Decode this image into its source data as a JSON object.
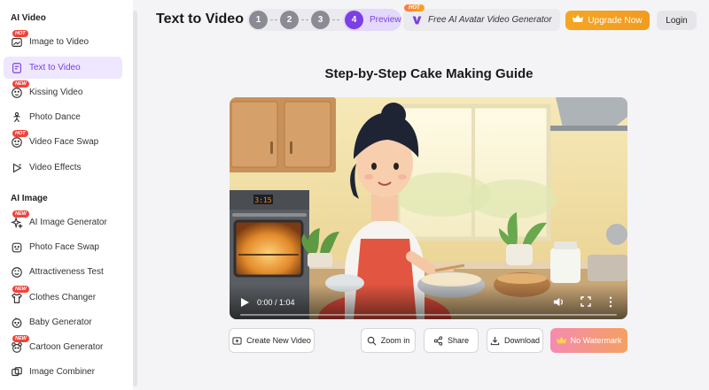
{
  "sidebar": {
    "sections": [
      {
        "title": "AI Video",
        "items": [
          {
            "label": "Image to Video",
            "icon": "image-video-icon",
            "badge": "HOT"
          },
          {
            "label": "Text to Video",
            "icon": "text-video-icon",
            "badge": "",
            "active": true
          },
          {
            "label": "Kissing Video",
            "icon": "kissing-icon",
            "badge": "NEW"
          },
          {
            "label": "Photo Dance",
            "icon": "dance-icon",
            "badge": ""
          },
          {
            "label": "Video Face Swap",
            "icon": "face-swap-icon",
            "badge": "HOT"
          },
          {
            "label": "Video Effects",
            "icon": "effects-icon",
            "badge": ""
          }
        ]
      },
      {
        "title": "AI Image",
        "items": [
          {
            "label": "AI Image Generator",
            "icon": "sparkle-icon",
            "badge": "NEW"
          },
          {
            "label": "Photo Face Swap",
            "icon": "face-icon",
            "badge": ""
          },
          {
            "label": "Attractiveness Test",
            "icon": "heart-face-icon",
            "badge": ""
          },
          {
            "label": "Clothes Changer",
            "icon": "shirt-icon",
            "badge": "NEW"
          },
          {
            "label": "Baby Generator",
            "icon": "baby-icon",
            "badge": ""
          },
          {
            "label": "Cartoon Generator",
            "icon": "cartoon-icon",
            "badge": "NEW"
          },
          {
            "label": "Image Combiner",
            "icon": "combine-icon",
            "badge": ""
          }
        ]
      }
    ]
  },
  "header": {
    "title": "Text to Video",
    "steps": [
      "1",
      "2",
      "3"
    ],
    "active_step": {
      "number": "4",
      "label": "Preview"
    },
    "promo": {
      "badge": "HOT",
      "text": "Free AI Avatar Video Generator"
    },
    "upgrade_label": "Upgrade Now",
    "login_label": "Login"
  },
  "main": {
    "video_title": "Step-by-Step Cake Making Guide",
    "player": {
      "time": "0:00 / 1:04",
      "progress": 0
    },
    "oven_display": "3:15",
    "buttons": {
      "create": "Create New Video",
      "zoom": "Zoom in",
      "share": "Share",
      "download": "Download",
      "watermark": "No Watermark"
    }
  },
  "colors": {
    "accent": "#7b3fe4",
    "active_bg": "#efe7ff",
    "upgrade": "#f5a623",
    "badge_red": "#f0433d"
  }
}
